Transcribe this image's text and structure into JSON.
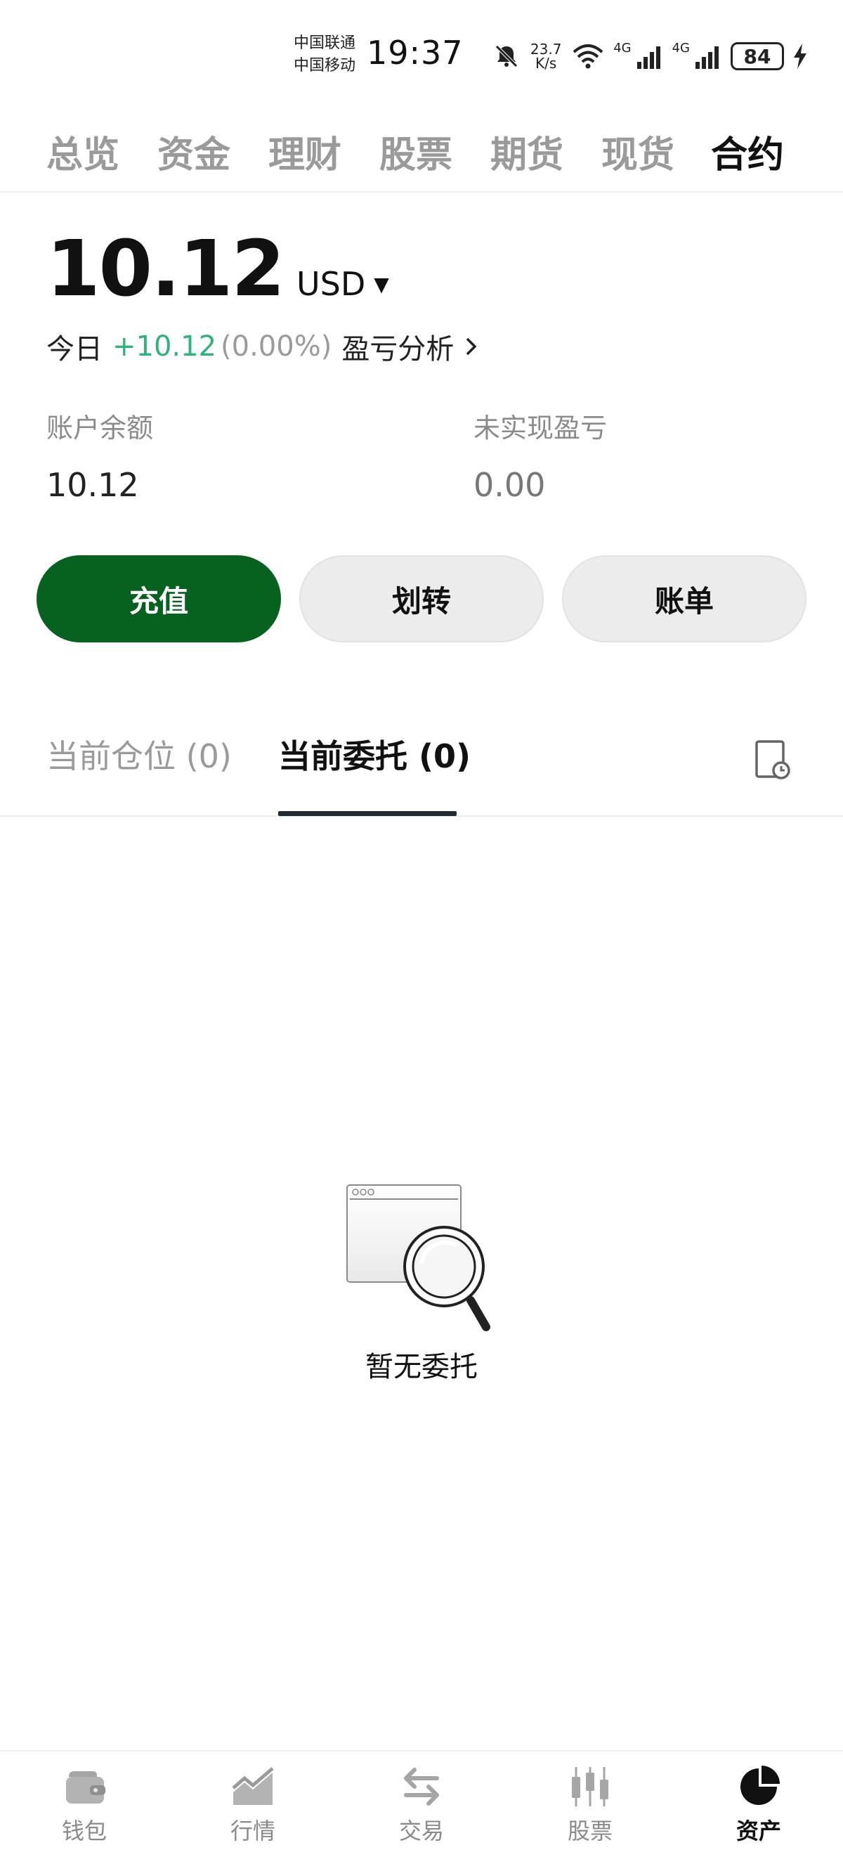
{
  "status_bar": {
    "carrier_1": "中国联通",
    "carrier_2": "中国移动",
    "time": "19:37",
    "net_speed_value": "23.7",
    "net_speed_unit": "K/s",
    "signal_label_1": "4G",
    "signal_label_2": "4G",
    "battery": "84"
  },
  "top_tabs": [
    {
      "label": "总览",
      "active": false
    },
    {
      "label": "资金",
      "active": false
    },
    {
      "label": "理财",
      "active": false
    },
    {
      "label": "股票",
      "active": false
    },
    {
      "label": "期货",
      "active": false
    },
    {
      "label": "现货",
      "active": false
    },
    {
      "label": "合约",
      "active": true
    }
  ],
  "summary": {
    "total_amount": "10.12",
    "currency": "USD",
    "today_label": "今日",
    "today_pnl": "+10.12",
    "today_pnl_pct": "(0.00%)",
    "pnl_analysis_link": "盈亏分析",
    "balance_label": "账户余额",
    "balance_value": "10.12",
    "unrealized_label": "未实现盈亏",
    "unrealized_value": "0.00"
  },
  "actions": {
    "deposit": "充值",
    "transfer": "划转",
    "bill": "账单"
  },
  "sub_tabs": [
    {
      "label": "当前仓位 (0)",
      "active": false
    },
    {
      "label": "当前委托 (0)",
      "active": true
    }
  ],
  "empty_state": {
    "text": "暂无委托"
  },
  "bottom_nav": [
    {
      "label": "钱包",
      "icon": "wallet-icon",
      "active": false
    },
    {
      "label": "行情",
      "icon": "market-chart-icon",
      "active": false
    },
    {
      "label": "交易",
      "icon": "swap-arrows-icon",
      "active": false
    },
    {
      "label": "股票",
      "icon": "candlestick-icon",
      "active": false
    },
    {
      "label": "资产",
      "icon": "pie-chart-icon",
      "active": true
    }
  ],
  "colors": {
    "primary_green": "#07621f",
    "profit_green": "#2fb37a",
    "tab_inactive": "#9a9a9a"
  }
}
